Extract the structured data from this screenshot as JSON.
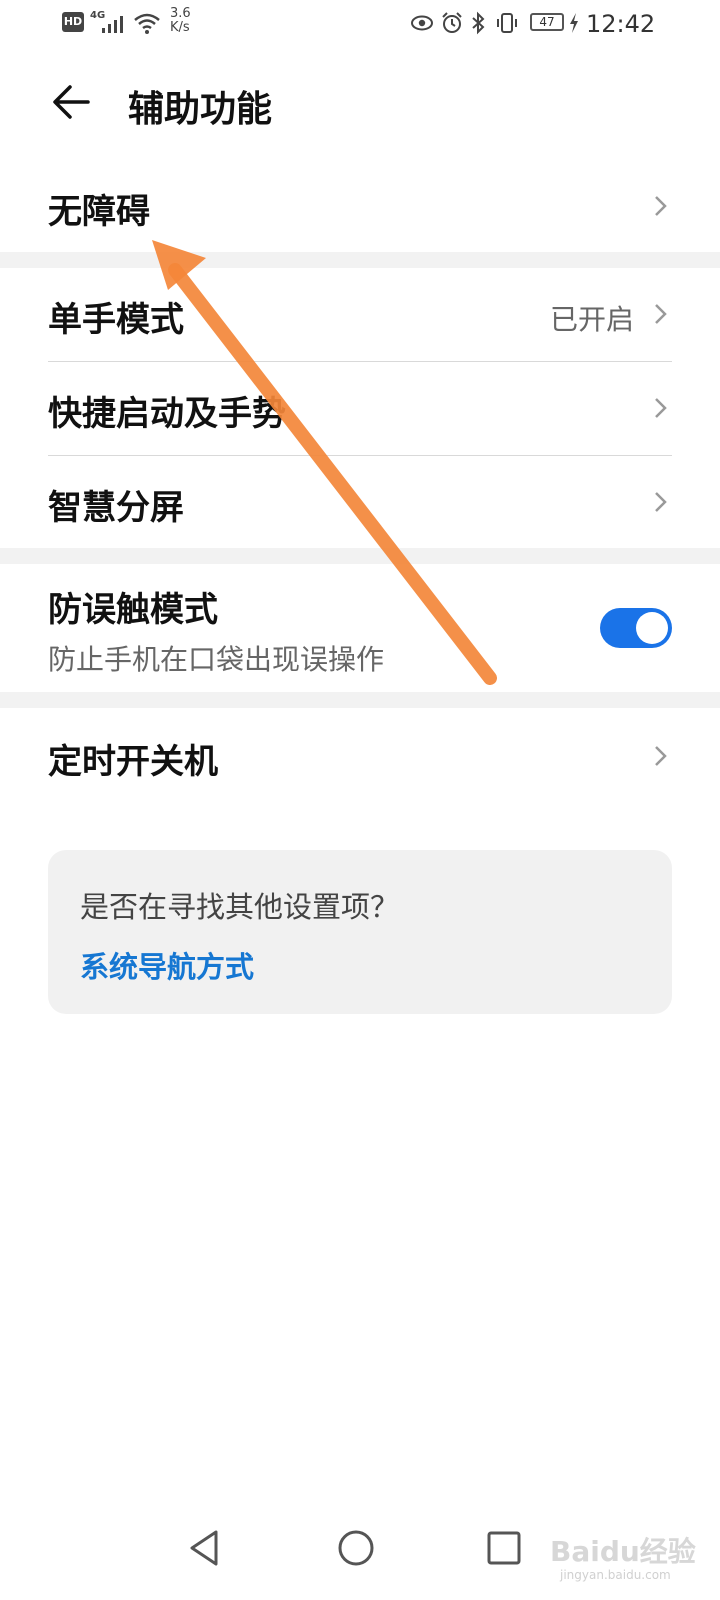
{
  "status_bar": {
    "hd": "HD",
    "network": "4G",
    "speed_value": "3.6",
    "speed_unit": "K/s",
    "battery": "47",
    "time": "12:42"
  },
  "header": {
    "title": "辅助功能"
  },
  "items": {
    "accessibility": {
      "label": "无障碍"
    },
    "one_hand": {
      "label": "单手模式",
      "value": "已开启"
    },
    "shortcuts": {
      "label": "快捷启动及手势"
    },
    "split_screen": {
      "label": "智慧分屏"
    },
    "pocket_mode": {
      "label": "防误触模式",
      "sublabel": "防止手机在口袋出现误操作",
      "enabled": true
    },
    "scheduled_power": {
      "label": "定时开关机"
    }
  },
  "suggestion_card": {
    "question": "是否在寻找其他设置项？",
    "link": "系统导航方式"
  },
  "watermark": {
    "brand": "Baidu经验",
    "url": "jingyan.baidu.com"
  },
  "colors": {
    "accent": "#1a73e8",
    "link": "#1677d2",
    "annotation_arrow": "#f4873a"
  }
}
